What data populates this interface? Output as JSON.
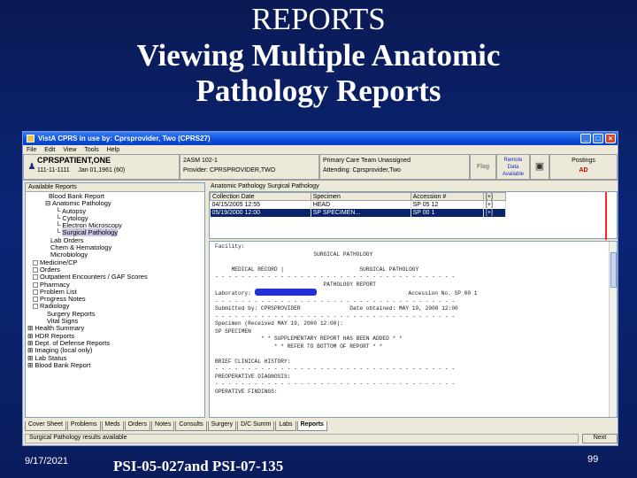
{
  "slide": {
    "title_line1": "REPORTS",
    "title_line2": "Viewing Multiple Anatomic",
    "title_line3": "Pathology Reports",
    "date": "9/17/2021",
    "footer": "PSI-05-027and PSI-07-135",
    "page_number": "99"
  },
  "window": {
    "title": "VistA CPRS in use by: Cprsprovider, Two (CPRS27)",
    "menu": [
      "File",
      "Edit",
      "View",
      "Tools",
      "Help"
    ]
  },
  "patient": {
    "name": "CPRSPATIENT,ONE",
    "id": "111-11-1111",
    "dob": "Jan 01,1961 (60)",
    "location": "2ASM 102-1",
    "provider": "Provider: CPRSPROVIDER,TWO",
    "team": "Primary Care Team Unassigned",
    "attending": "Attending: Cprsprovider,Two",
    "flag": "Flag",
    "remote_1": "Remote",
    "remote_2": "Data",
    "remote_3": "Available",
    "postings": "Postings",
    "postings_code": "AD"
  },
  "left": {
    "header": "Available Reports",
    "items": [
      "Blood Bank Report",
      "Anatomic Pathology",
      "Autopsy",
      "Cytology",
      "Electron Microscopy",
      "Surgical Pathology",
      "Lab Orders",
      "Chem & Hematology",
      "Microbiology",
      "Medicine/CP",
      "Orders",
      "Outpatient Encounters / GAF Scores",
      "Pharmacy",
      "Problem List",
      "Progress Notes",
      "Radiology",
      "Surgery Reports",
      "Vital Signs",
      "Health Summary",
      "HDR Reports",
      "Dept. of Defense Reports",
      "Imaging (local only)",
      "Lab Status",
      "Blood Bank Report"
    ]
  },
  "right": {
    "header": "Anatomic Pathology Surgical Pathology",
    "columns": [
      "Collection Date",
      "Specimen",
      "Accession #"
    ],
    "rows": [
      [
        "04/15/2005 12:55",
        "HEAD",
        "SP 05 12"
      ],
      [
        "05/19/2000 12:00",
        "SP SPECIMEN...",
        "SP 00 1"
      ]
    ],
    "report_lines": [
      "Facility:",
      "                              SURGICAL PATHOLOGY",
      "",
      "     MEDICAL RECORD |                       SURGICAL PATHOLOGY",
      "- - - - - - - - - - - - - - - - - - - - - - - - - - - - - - - - - - - - -",
      "                                 PATHOLOGY REPORT",
      "Laboratory:                                          Accession No. SP 00 1",
      "- - - - - - - - - - - - - - - - - - - - - - - - - - - - - - - - - - - - -",
      "Submitted by: CPRSPROVIDER               Date obtained: MAY 19, 2000 12:00",
      "- - - - - - - - - - - - - - - - - - - - - - - - - - - - - - - - - - - - -",
      "Specimen (Received MAY 19, 2000 12:00):",
      "SP SPECIMEN",
      "              * * SUPPLEMENTARY REPORT HAS BEEN ADDED * *",
      "                  * * REFER TO BOTTOM OF REPORT * *",
      "",
      "BRIEF CLINICAL HISTORY:",
      "- - - - - - - - - - - - - - - - - - - - - - - - - - - - - - - - - - - - -",
      "PREOPERATIVE DIAGNOSIS:",
      "- - - - - - - - - - - - - - - - - - - - - - - - - - - - - - - - - - - - -",
      "OPERATIVE FINDINGS:"
    ]
  },
  "tabs": [
    "Cover Sheet",
    "Problems",
    "Meds",
    "Orders",
    "Notes",
    "Consults",
    "Surgery",
    "D/C Summ",
    "Labs",
    "Reports"
  ],
  "status": "Surgical Pathology results available",
  "next_button": "Next"
}
